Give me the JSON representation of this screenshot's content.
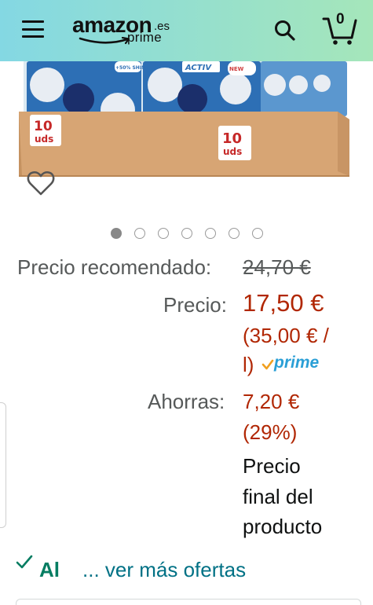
{
  "header": {
    "logo_word": "amazon",
    "logo_tld": ".es",
    "logo_sub": "prime",
    "cart_count": "0",
    "colors": {
      "gradient_start": "#84d8e3",
      "gradient_end": "#a5e6ba"
    },
    "icons": {
      "menu": "hamburger-menu-icon",
      "search": "search-icon",
      "cart": "cart-icon"
    }
  },
  "product_image": {
    "box_label_left_1": "10",
    "box_label_left_2": "uds",
    "box_label_right_1": "10",
    "box_label_right_2": "uds",
    "pack_brand": "ACTIV",
    "pack_badge": "+50% SHINE",
    "pack_new": "NEW"
  },
  "carousel": {
    "count": 7,
    "active_index": 0
  },
  "pricing": {
    "recommended_label": "Precio recomendado:",
    "recommended_value": "24,70 €",
    "price_label": "Precio:",
    "price_value": "17,50 €",
    "unit_price_line1": "(35,00 € /",
    "unit_price_line2": "l)",
    "prime_label": "prime",
    "savings_label": "Ahorras:",
    "savings_value": "7,20 €",
    "savings_percent": "(29%)",
    "final_line1": "Precio",
    "final_line2": "final del",
    "final_line3": "producto"
  },
  "availability": {
    "status_text": "Al",
    "more_offers_link": "... ver más ofertas"
  },
  "colors": {
    "price_red": "#b12704",
    "link_teal": "#007185",
    "stock_green": "#067d62",
    "prime_blue": "#2a9fd6"
  }
}
